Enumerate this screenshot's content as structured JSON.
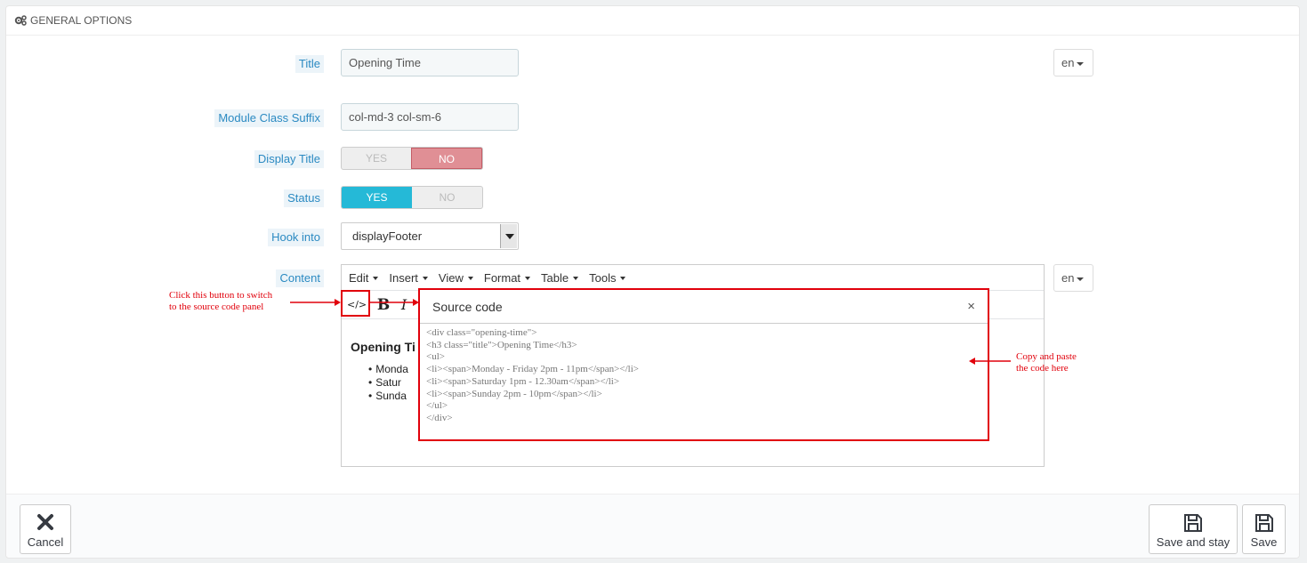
{
  "panel": {
    "heading": "GENERAL OPTIONS",
    "heading_icon": "cogs-icon"
  },
  "form": {
    "title": {
      "label": "Title",
      "value": "Opening Time",
      "lang": "en"
    },
    "module_class_suffix": {
      "label": "Module Class Suffix",
      "value": "col-md-3 col-sm-6"
    },
    "display_title": {
      "label": "Display Title",
      "yes": "YES",
      "no": "NO",
      "selected": "NO"
    },
    "status": {
      "label": "Status",
      "yes": "YES",
      "no": "NO",
      "selected": "YES"
    },
    "hook_into": {
      "label": "Hook into",
      "value": "displayFooter"
    },
    "content": {
      "label": "Content",
      "lang": "en",
      "menu": [
        "Edit",
        "Insert",
        "View",
        "Format",
        "Table",
        "Tools"
      ],
      "toolbar": {
        "source_code": "</>",
        "bold": "B",
        "italic": "I"
      },
      "preview": {
        "heading": "Opening Ti",
        "items": [
          "Monda",
          "Satur",
          "Sunda"
        ]
      }
    }
  },
  "dialog": {
    "title": "Source code",
    "close": "×",
    "code_lines": [
      "<div class=\"opening-time\">",
      "<h3 class=\"title\">Opening Time</h3>",
      "<ul>",
      "<li><span>Monday - Friday 2pm - 11pm</span></li>",
      "<li><span>Saturday 1pm - 12.30am</span></li>",
      "<li><span>Sunday 2pm - 10pm</span></li>",
      "</ul>",
      "</div>"
    ]
  },
  "annotations": {
    "switch_hint": [
      "Click this button to switch",
      "to the source code panel"
    ],
    "paste_hint": [
      "Copy and paste",
      "the code here"
    ],
    "color": "#e1000b"
  },
  "footer": {
    "cancel": "Cancel",
    "save_and_stay": "Save and stay",
    "save": "Save"
  },
  "colors": {
    "label_text": "#2b8ac2",
    "label_bg": "#ecf4f9",
    "switch_no": "#e08f95",
    "switch_yes": "#25b9d7"
  }
}
